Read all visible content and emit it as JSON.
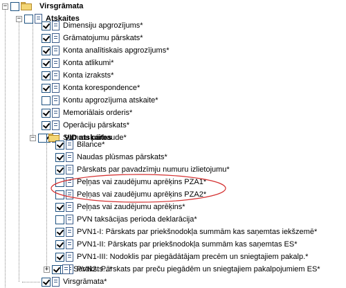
{
  "tree": {
    "root": {
      "label": "Virsgrāmata",
      "expander": "−"
    },
    "atskaites": {
      "label": "Atskaites",
      "expander": "−",
      "items": [
        {
          "label": "Dimensiju apgrozījums*",
          "checked": true
        },
        {
          "label": "Grāmatojumu pārskats*",
          "checked": true
        },
        {
          "label": "Konta analītiskais apgrozījums*",
          "checked": true
        },
        {
          "label": "Konta atlikumi*",
          "checked": true
        },
        {
          "label": "Konta izraksts*",
          "checked": true
        },
        {
          "label": "Konta korespondence*",
          "checked": true
        },
        {
          "label": "Kontu apgrozījuma atskaite*",
          "checked": false
        },
        {
          "label": "Memoriālais orderis*",
          "checked": true
        },
        {
          "label": "Operāciju pārskats*",
          "checked": true
        },
        {
          "label": "Summu pārbaude*",
          "checked": true
        }
      ]
    },
    "vid": {
      "label": "VID atskaites",
      "expander": "−",
      "items": [
        {
          "label": "Bilance*",
          "checked": true
        },
        {
          "label": "Naudas plūsmas pārskats*",
          "checked": true
        },
        {
          "label": "Pārskats par pavadzīmju numuru izlietojumu*",
          "checked": true
        },
        {
          "label": "Peļņas vai zaudējumu aprēķins PZA1*",
          "checked": false
        },
        {
          "label": "Peļņas vai zaudējumu aprēķins PZA2*",
          "checked": false
        },
        {
          "label": "Peļņas vai zaudējumu aprēķins*",
          "checked": true
        },
        {
          "label": "PVN taksācijas perioda deklarācija*",
          "checked": false
        },
        {
          "label": "PVN1-I: Pārskats par priekšnodokļa summām kas saņemtas iekšzemē*",
          "checked": true
        },
        {
          "label": "PVN1-II: Pārskats par priekšnodokļa summām kas saņemtas ES*",
          "checked": true
        },
        {
          "label": "PVN1-III: Nodoklis par piegādātājam precēm un sniegtajiem pakalp.*",
          "checked": true
        },
        {
          "label": "PVN2: Pārskats par preču piegādēm un sniegtajiem pakalpojumiem ES*",
          "checked": false
        }
      ]
    },
    "saraksts": {
      "label": "Saraksts...*",
      "expander": "+",
      "checked": true
    },
    "virsgramata": {
      "label": "Virsgrāmata*",
      "checked": true
    }
  },
  "highlight_color": "#d43030",
  "line_color": "#8a8a8a"
}
